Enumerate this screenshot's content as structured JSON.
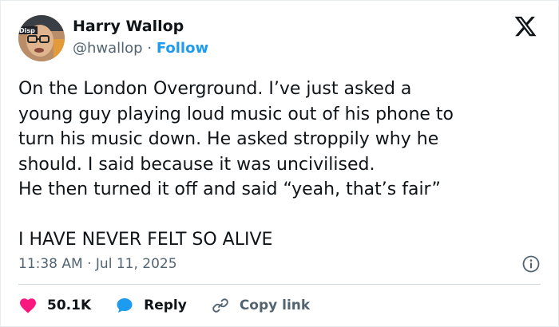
{
  "author": {
    "display_name": "Harry Wallop",
    "handle": "@hwallop",
    "separator": "·",
    "follow_label": "Follow",
    "avatar_icon": "profile-photo",
    "avatar_badge_text": "Disp"
  },
  "brand": {
    "logo_icon": "x-logo-icon"
  },
  "tweet": {
    "lines": [
      "On the London Overground. I’ve just asked a",
      "young guy playing loud music out of his phone to",
      "turn his music down. He asked stroppily why he",
      "should. I said because it was uncivilised.",
      "He then turned it off and said “yeah, that’s fair”",
      "I HAVE NEVER FELT SO ALIVE"
    ]
  },
  "meta": {
    "timestamp": "11:38 AM · Jul 11, 2025",
    "info_icon": "info-icon"
  },
  "actions": {
    "like_count": "50.1K",
    "reply_label": "Reply",
    "copy_link_label": "Copy link"
  },
  "colors": {
    "accent": "#1d9bf0",
    "like": "#f91880",
    "text": "#0f1419",
    "secondary": "#536471"
  }
}
